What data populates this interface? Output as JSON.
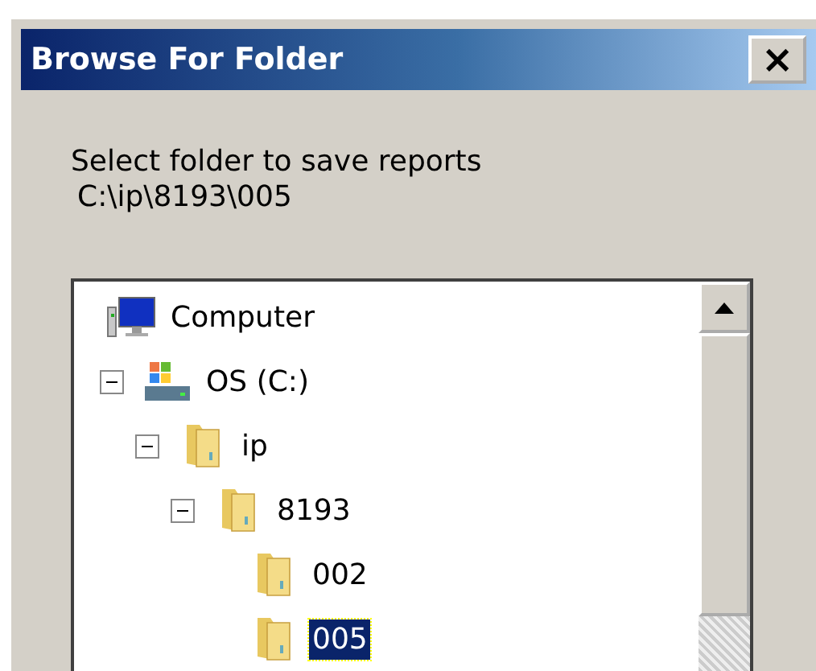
{
  "window": {
    "title": "Browse For Folder",
    "close": "×"
  },
  "description": "Select folder to save reports",
  "path": "C:\\ip\\8193\\005",
  "tree": [
    {
      "label": "Computer",
      "kind": "computer",
      "selected": false,
      "children": [
        {
          "label": "OS (C:)",
          "kind": "drive",
          "expanded": true,
          "selected": false,
          "children": [
            {
              "label": "ip",
              "kind": "folder",
              "expanded": true,
              "selected": false,
              "children": [
                {
                  "label": "8193",
                  "kind": "folder",
                  "expanded": true,
                  "selected": false,
                  "children": [
                    {
                      "label": "002",
                      "kind": "folder",
                      "selected": false
                    },
                    {
                      "label": "005",
                      "kind": "folder",
                      "selected": true
                    }
                  ]
                }
              ]
            }
          ]
        }
      ]
    }
  ]
}
